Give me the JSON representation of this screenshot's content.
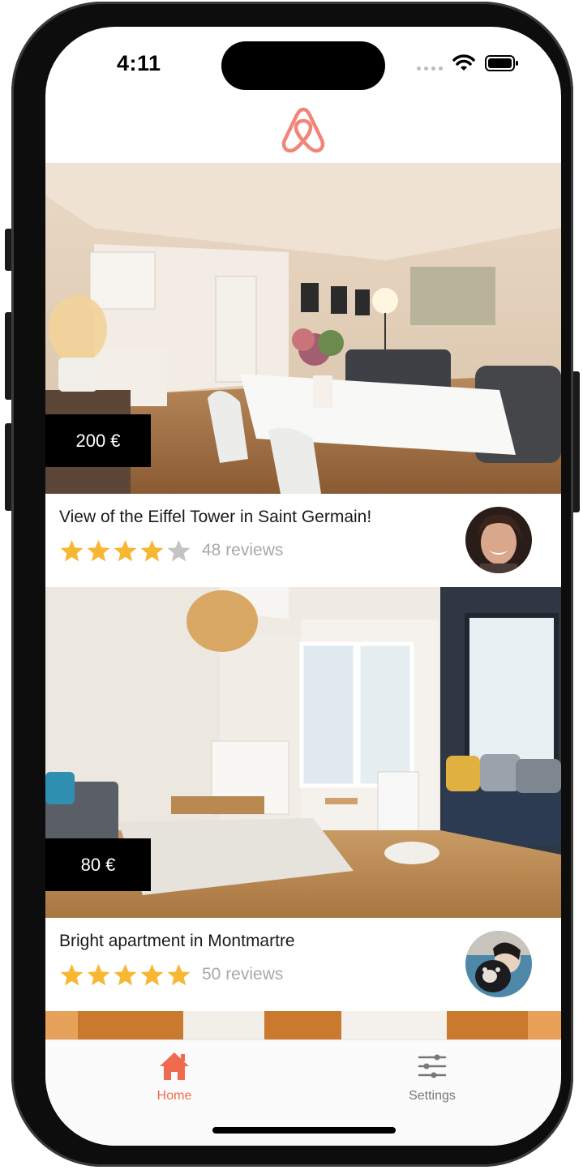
{
  "status_bar": {
    "time": "4:11"
  },
  "header": {
    "logo": "airbnb-logo"
  },
  "listings": [
    {
      "price": "200 €",
      "title": "View of the Eiffel Tower in Saint Germain!",
      "rating": 4,
      "max_rating": 5,
      "reviews": "48 reviews"
    },
    {
      "price": "80 €",
      "title": "Bright apartment in Montmartre",
      "rating": 5,
      "max_rating": 5,
      "reviews": "50 reviews"
    }
  ],
  "tabs": [
    {
      "label": "Home",
      "icon": "home-icon",
      "active": true
    },
    {
      "label": "Settings",
      "icon": "sliders-icon",
      "active": false
    }
  ],
  "colors": {
    "accent": "#f06b4d",
    "logo": "#f2857a",
    "star_filled": "#f7b733",
    "star_empty": "#c4c4c4",
    "inactive_tab": "#777777"
  }
}
